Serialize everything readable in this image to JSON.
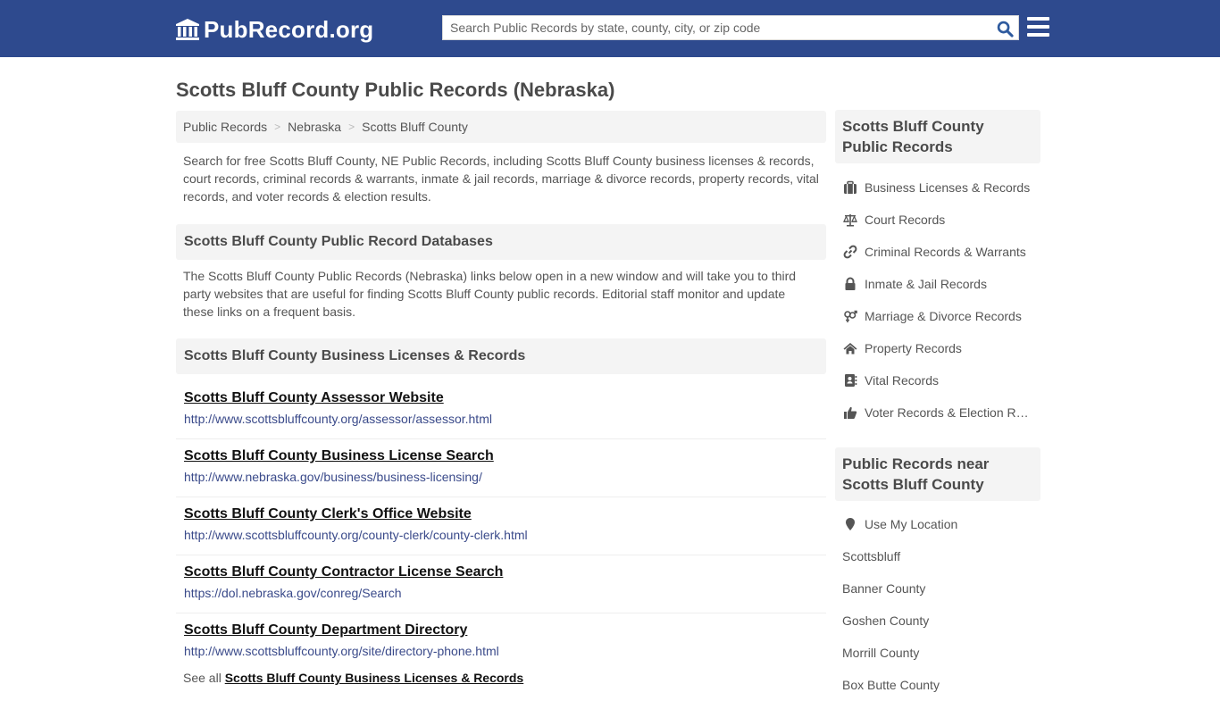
{
  "header": {
    "logo_text": "PubRecord.org",
    "search_placeholder": "Search Public Records by state, county, city, or zip code",
    "search_value": ""
  },
  "page": {
    "title": "Scotts Bluff County Public Records (Nebraska)",
    "breadcrumb": [
      "Public Records",
      "Nebraska",
      "Scotts Bluff County"
    ],
    "breadcrumb_separator": ">",
    "intro": "Search for free Scotts Bluff County, NE Public Records, including Scotts Bluff County business licenses & records, court records, criminal records & warrants, inmate & jail records, marriage & divorce records, property records, vital records, and voter records & election results."
  },
  "databases": {
    "heading": "Scotts Bluff County Public Record Databases",
    "description": "The Scotts Bluff County Public Records (Nebraska) links below open in a new window and will take you to third party websites that are useful for finding Scotts Bluff County public records. Editorial staff monitor and update these links on a frequent basis."
  },
  "business": {
    "heading": "Scotts Bluff County Business Licenses & Records",
    "links": [
      {
        "title": "Scotts Bluff County Assessor Website",
        "url": "http://www.scottsbluffcounty.org/assessor/assessor.html"
      },
      {
        "title": "Scotts Bluff County Business License Search",
        "url": "http://www.nebraska.gov/business/business-licensing/"
      },
      {
        "title": "Scotts Bluff County Clerk's Office Website",
        "url": "http://www.scottsbluffcounty.org/county-clerk/county-clerk.html"
      },
      {
        "title": "Scotts Bluff County Contractor License Search",
        "url": "https://dol.nebraska.gov/conreg/Search"
      },
      {
        "title": "Scotts Bluff County Department Directory",
        "url": "http://www.scottsbluffcounty.org/site/directory-phone.html"
      }
    ],
    "see_all_prefix": "See all",
    "see_all_link": "Scotts Bluff County Business Licenses & Records"
  },
  "sidebar": {
    "records_heading": "Scotts Bluff County Public Records",
    "records": [
      {
        "label": "Business Licenses & Records",
        "icon": "briefcase-icon"
      },
      {
        "label": "Court Records",
        "icon": "balance-scale-icon"
      },
      {
        "label": "Criminal Records & Warrants",
        "icon": "link-icon"
      },
      {
        "label": "Inmate & Jail Records",
        "icon": "lock-icon"
      },
      {
        "label": "Marriage & Divorce Records",
        "icon": "gender-icon"
      },
      {
        "label": "Property Records",
        "icon": "home-icon"
      },
      {
        "label": "Vital Records",
        "icon": "address-book-icon"
      },
      {
        "label": "Voter Records & Election Results",
        "icon": "thumbs-up-icon"
      }
    ],
    "nearby_heading": "Public Records near Scotts Bluff County",
    "use_location": "Use My Location",
    "nearby": [
      "Scottsbluff",
      "Banner County",
      "Goshen County",
      "Morrill County",
      "Box Butte County"
    ]
  },
  "colors": {
    "brand": "#2e4a8e",
    "panel": "#f4f4f4",
    "url": "#3a4a8a"
  }
}
